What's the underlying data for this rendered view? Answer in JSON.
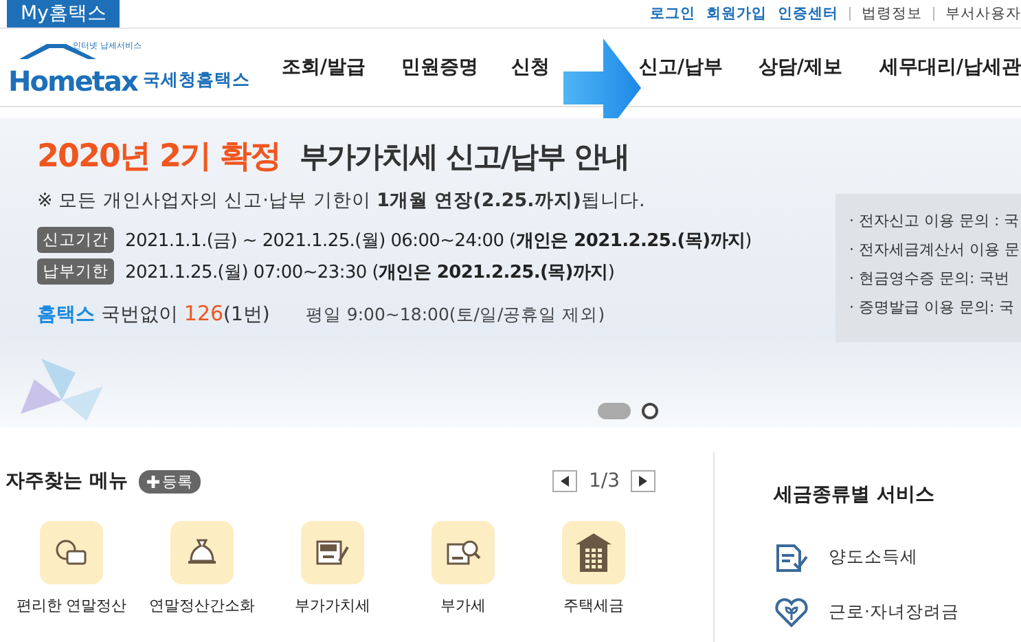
{
  "my_tab": "My홈택스",
  "top_links": [
    {
      "label": "로그인",
      "kind": "primary"
    },
    {
      "label": "회원가입",
      "kind": "primary"
    },
    {
      "label": "인증센터",
      "kind": "primary"
    },
    {
      "label": "법령정보",
      "kind": "plain"
    },
    {
      "label": "부서사용자",
      "kind": "plain"
    }
  ],
  "logo": {
    "tagline": "인터넷 납세서비스",
    "wordmark": "Hometax",
    "name": "국세청홈택스"
  },
  "nav": [
    "조회/발급",
    "민원증명",
    "신청",
    "신고/납부",
    "상담/제보",
    "세무대리/납세관"
  ],
  "banner": {
    "headline_highlight": "2020년 2기 확정",
    "headline": "부가가치세 신고/납부 안내",
    "notice": "※ 모든 개인사업자의 신고·납부 기한이 **1개월 연장(2.25.까지)**됩니다.",
    "periods": [
      {
        "label": "신고기간",
        "text": "2021.1.1.(금) ~ 2021.1.25.(월) 06:00~24:00 (**개인은 2021.2.25.(목)까지**)"
      },
      {
        "label": "납부기한",
        "text": "2021.1.25.(월) 07:00~23:30 (**개인은 2021.2.25.(목)까지**)"
      }
    ],
    "contact": {
      "brand": "홈택스",
      "prefix": "국번없이",
      "number": "126",
      "suffix": "(1번)"
    },
    "hours": "평일 9:00~18:00(토/일/공휴일 제외)",
    "side_info": [
      "· 전자신고 이용 문의 : 국",
      "· 전자세금계산서 이용 문",
      "· 현금영수증 문의: 국번",
      "· 증명발급 이용 문의: 국"
    ],
    "pager": [
      {
        "selected": true
      },
      {
        "selected": false
      }
    ]
  },
  "favorites": {
    "title": "자주찾는 메뉴",
    "add_button": "등록",
    "page": "1/3",
    "items": [
      {
        "label": "편리한 연말정산"
      },
      {
        "label": "연말정산간소화"
      },
      {
        "label": "부가가치세"
      },
      {
        "label": "부가세"
      },
      {
        "label": "주택세금"
      }
    ]
  },
  "tax_services": {
    "title": "세금종류별 서비스",
    "items": [
      {
        "label": "양도소득세"
      },
      {
        "label": "근로·자녀장려금"
      }
    ]
  }
}
